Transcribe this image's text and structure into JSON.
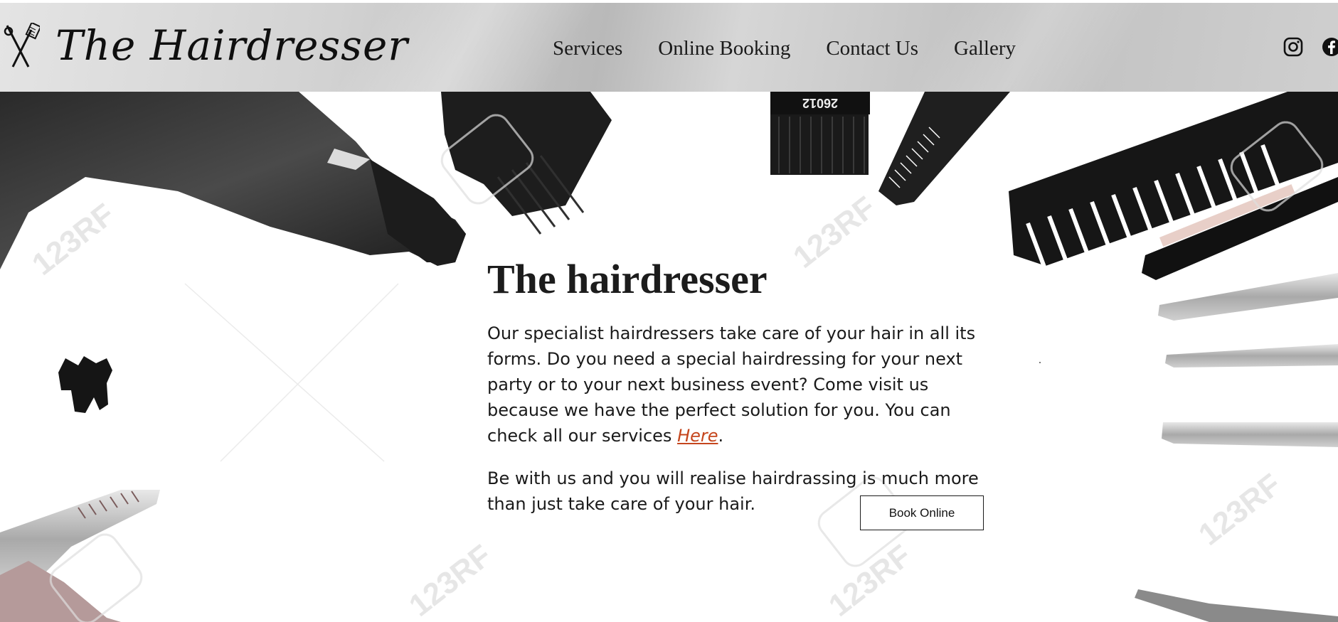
{
  "header": {
    "logo_text": "The Hairdresser",
    "nav": [
      "Services",
      "Online Booking",
      "Contact Us",
      "Gallery"
    ],
    "social": [
      "instagram-icon",
      "facebook-icon"
    ]
  },
  "hero": {
    "title": "The hairdresser",
    "paragraph1_before_link": "Our specialist hairdressers take care of your hair in all its forms. Do you need a special hairdressing for your next party or to your next business event? Come visit us because we have the perfect solution for you. You can check all our services ",
    "link_text": "Here",
    "paragraph1_after_link": ".",
    "paragraph2": "Be with us and you will realise hairdrassing is much more than just take care of your hair.",
    "book_button": "Book Online",
    "watermark": "123RF"
  },
  "colors": {
    "link": "#c5461d",
    "text": "#1a1a1a",
    "header_bg": "#cfcfcf"
  }
}
